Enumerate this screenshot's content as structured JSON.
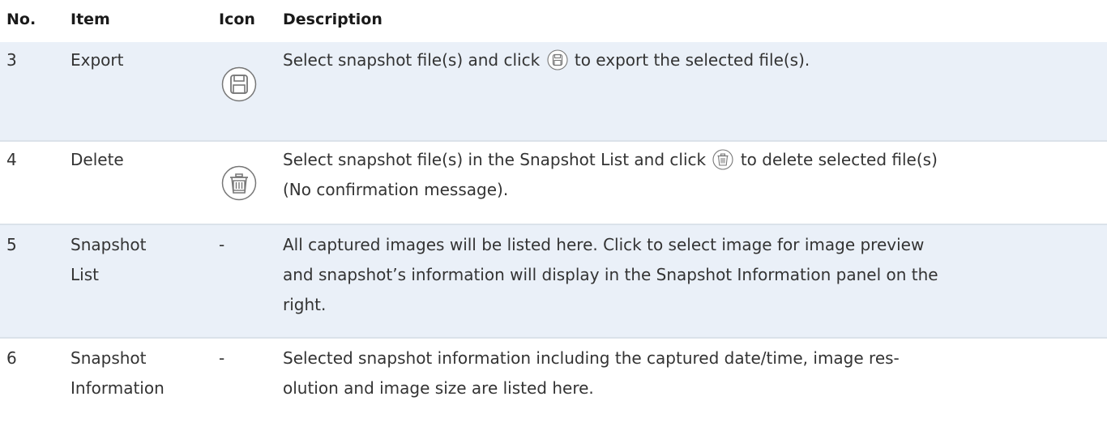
{
  "header": {
    "no": "No.",
    "item": "Item",
    "icon": "Icon",
    "description": "Description"
  },
  "rows": [
    {
      "no": "3",
      "item": "Export",
      "icon": "save-icon",
      "desc_before": "Select snapshot file(s) and click",
      "desc_after": "to export the selected file(s)."
    },
    {
      "no": "4",
      "item": "Delete",
      "icon": "trash-icon",
      "desc_before": "Select snapshot file(s) in the Snapshot List and click",
      "desc_after": "to delete selected file(s)",
      "desc_line2": "(No confirmation message)."
    },
    {
      "no": "5",
      "item_line1": "Snapshot",
      "item_line2": "List",
      "icon": "-",
      "desc_line1": "All captured images will be listed here. Click to select image for image preview",
      "desc_line2": "and snapshot’s information will display in the Snapshot Information panel on the",
      "desc_line3": "right."
    },
    {
      "no": "6",
      "item_line1": "Snapshot",
      "item_line2": "Information",
      "icon": "-",
      "desc_line1": "Selected snapshot information including the captured date/time, image res-",
      "desc_line2": "olution and image size are listed here."
    }
  ],
  "colors": {
    "shaded_row": "#eaf0f8",
    "divider": "#dbe2ea",
    "text": "#333333"
  }
}
